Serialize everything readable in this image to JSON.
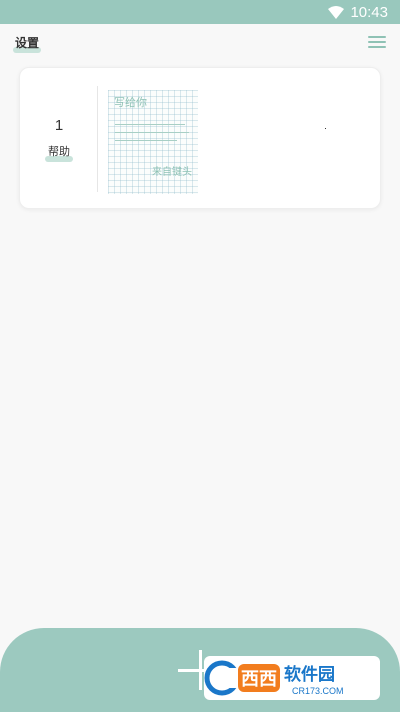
{
  "status_bar": {
    "time": "10:43",
    "wifi_icon": "wifi-icon",
    "background": "#99c8bd"
  },
  "header": {
    "title": "设置",
    "menu_icon": "hamburger-menu-icon"
  },
  "entries": [
    {
      "number": "1",
      "label": "帮助",
      "preview": {
        "title": "写给你",
        "signature": "来自键头"
      }
    }
  ],
  "fab": {
    "icon": "plus-icon"
  },
  "watermark": {
    "brand": "西西软件园",
    "url": "CR173.COM"
  },
  "colors": {
    "accent": "#8fc2b5",
    "bar": "#9cc9bf",
    "highlight": "#c9e3db"
  }
}
